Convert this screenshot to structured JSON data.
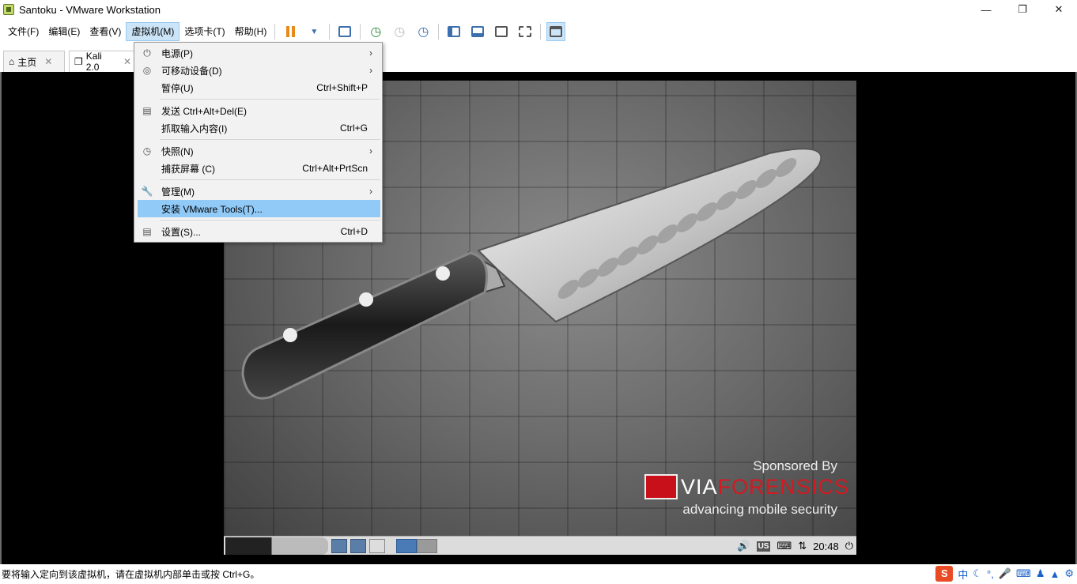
{
  "window": {
    "title": "Santoku - VMware Workstation"
  },
  "menubar": [
    "文件(F)",
    "编辑(E)",
    "查看(V)",
    "虚拟机(M)",
    "选项卡(T)",
    "帮助(H)"
  ],
  "tabs": [
    {
      "label": "主页"
    },
    {
      "label": "Kali 2.0"
    }
  ],
  "context_menu": {
    "items": [
      {
        "label": "电源(P)",
        "shortcut": "",
        "submenu": true
      },
      {
        "label": "可移动设备(D)",
        "shortcut": "",
        "submenu": true
      },
      {
        "label": "暂停(U)",
        "shortcut": "Ctrl+Shift+P",
        "submenu": false
      },
      {
        "label": "发送 Ctrl+Alt+Del(E)",
        "shortcut": "",
        "submenu": false
      },
      {
        "label": "抓取输入内容(I)",
        "shortcut": "Ctrl+G",
        "submenu": false
      },
      {
        "label": "快照(N)",
        "shortcut": "",
        "submenu": true
      },
      {
        "label": "捕获屏幕 (C)",
        "shortcut": "Ctrl+Alt+PrtScn",
        "submenu": false
      },
      {
        "label": "管理(M)",
        "shortcut": "",
        "submenu": true
      },
      {
        "label": "安装 VMware Tools(T)...",
        "shortcut": "",
        "submenu": false,
        "highlighted": true
      },
      {
        "label": "设置(S)...",
        "shortcut": "Ctrl+D",
        "submenu": false
      }
    ]
  },
  "guest": {
    "sponsor": "Sponsored By",
    "brand_a": "VIA",
    "brand_b": "FORENSICS",
    "tagline": "advancing mobile security",
    "panel": {
      "keyboard_layout": "US",
      "clock": "20:48"
    }
  },
  "status": {
    "text": "要将输入定向到该虚拟机，请在虚拟机内部单击或按 Ctrl+G。",
    "ime": "中"
  },
  "colors": {
    "highlight": "#91c9f7",
    "menu_active": "#cce4f7",
    "brand_red": "#c8101a"
  }
}
